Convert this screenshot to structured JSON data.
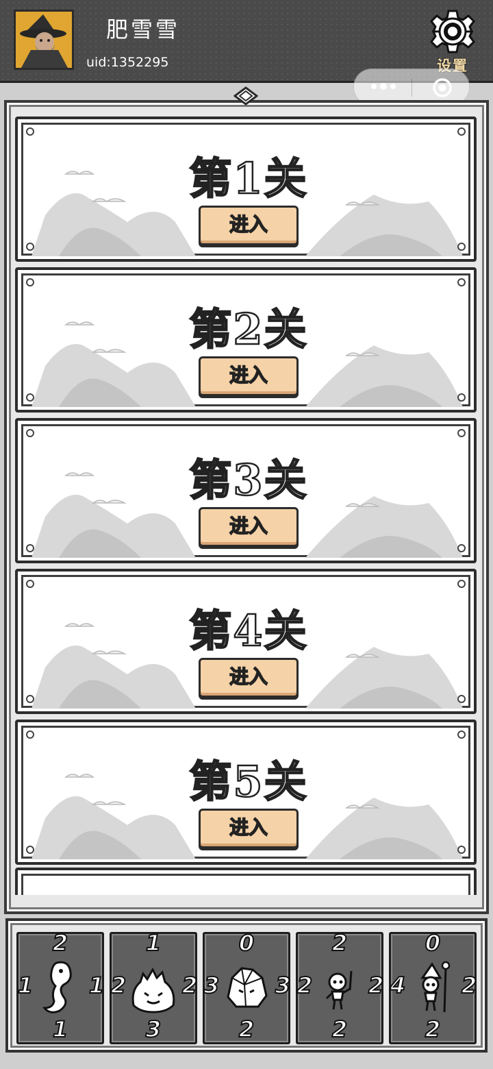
{
  "header": {
    "username": "肥雪雪",
    "uid": "uid:1352295",
    "settings_label": "设置"
  },
  "levels": [
    {
      "title": "第1关",
      "button": "进入"
    },
    {
      "title": "第2关",
      "button": "进入"
    },
    {
      "title": "第3关",
      "button": "进入"
    },
    {
      "title": "第4关",
      "button": "进入"
    },
    {
      "title": "第5关",
      "button": "进入"
    }
  ],
  "cards": [
    {
      "top": "2",
      "left": "1",
      "right": "1",
      "bottom": "1",
      "art": "worm-icon"
    },
    {
      "top": "1",
      "left": "2",
      "right": "2",
      "bottom": "3",
      "art": "slime-icon"
    },
    {
      "top": "0",
      "left": "3",
      "right": "3",
      "bottom": "2",
      "art": "rock-golem-icon"
    },
    {
      "top": "2",
      "left": "2",
      "right": "2",
      "bottom": "2",
      "art": "skeleton-icon"
    },
    {
      "top": "0",
      "left": "4",
      "right": "2",
      "bottom": "2",
      "art": "skeleton-mage-icon"
    }
  ],
  "colors": {
    "header_bg": "#4a4a4a",
    "button_bg": "#f5d2a7",
    "card_bg": "#5f5f5f",
    "settings_label": "#f2d9a6"
  }
}
